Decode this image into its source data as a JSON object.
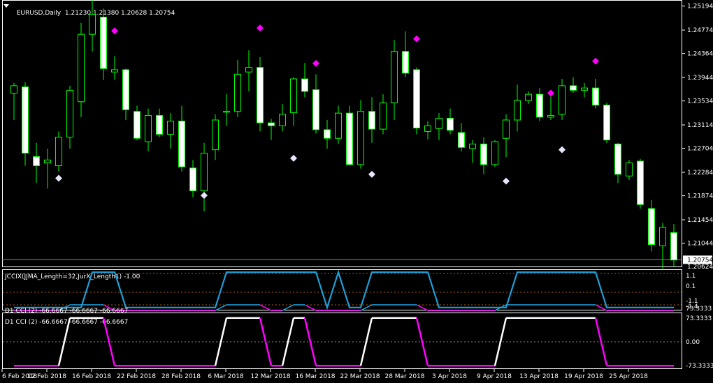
{
  "header": {
    "symbol": "EURUSD,Daily",
    "ohlc": "1.21230 1.21380 1.20628 1.20754"
  },
  "price_axis": {
    "labels": [
      "1.25194",
      "1.24774",
      "1.24364",
      "1.23944",
      "1.23534",
      "1.23114",
      "1.22704",
      "1.22284",
      "1.21874",
      "1.21454",
      "1.21044"
    ],
    "current_price": "1.20754",
    "bottom_label": "1.20624"
  },
  "indicator1": {
    "title": "JCCIX(JJMA_Length=32,JurX_Length1) -1.00",
    "axis_labels": [
      "1.1",
      "0.1",
      "-1.1",
      "-1.4"
    ],
    "overlay_title": "D1 CCI (2) -66.6667 -66.6667 -66.6667",
    "overlay_axis": "73.3333"
  },
  "indicator2": {
    "title": "D1 CCI (2) -66.6667 -66.6667 -66.6667",
    "axis_labels": [
      "73.3333",
      "0.00",
      "-73.3333"
    ]
  },
  "time_axis": {
    "labels": [
      "6 Feb 2018",
      "12 Feb 2018",
      "16 Feb 2018",
      "22 Feb 2018",
      "28 Feb 2018",
      "6 Mar 2018",
      "12 Mar 2018",
      "16 Mar 2018",
      "22 Mar 2018",
      "28 Mar 2018",
      "3 Apr 2018",
      "9 Apr 2018",
      "13 Apr 2018",
      "19 Apr 2018",
      "25 Apr 2018"
    ]
  },
  "colors": {
    "background": "#000000",
    "bull_candle": "#00ff00",
    "bear_body": "#ffffff",
    "fractal_up": "#ff00ff",
    "fractal_down": "#e6e6fa",
    "jccix_line": "#1e9fd8",
    "cci_high": "#ffffff",
    "cci_low": "#ff00ff",
    "grid": "#b06000"
  },
  "chart_data": {
    "type": "candlestick",
    "candles": [
      {
        "o": 1.2367,
        "h": 1.2385,
        "l": 1.232,
        "c": 1.238
      },
      {
        "o": 1.2378,
        "h": 1.2386,
        "l": 1.224,
        "c": 1.2262
      },
      {
        "o": 1.2256,
        "h": 1.228,
        "l": 1.221,
        "c": 1.224
      },
      {
        "o": 1.2245,
        "h": 1.227,
        "l": 1.22,
        "c": 1.225
      },
      {
        "o": 1.224,
        "h": 1.23,
        "l": 1.223,
        "c": 1.229
      },
      {
        "o": 1.229,
        "h": 1.238,
        "l": 1.227,
        "c": 1.2372
      },
      {
        "o": 1.2352,
        "h": 1.249,
        "l": 1.2325,
        "c": 1.247
      },
      {
        "o": 1.247,
        "h": 1.254,
        "l": 1.244,
        "c": 1.2505
      },
      {
        "o": 1.25,
        "h": 1.2515,
        "l": 1.239,
        "c": 1.241
      },
      {
        "o": 1.2404,
        "h": 1.2432,
        "l": 1.239,
        "c": 1.2408
      },
      {
        "o": 1.2408,
        "h": 1.241,
        "l": 1.232,
        "c": 1.2338
      },
      {
        "o": 1.2335,
        "h": 1.2345,
        "l": 1.2285,
        "c": 1.2288
      },
      {
        "o": 1.2282,
        "h": 1.234,
        "l": 1.2265,
        "c": 1.2328
      },
      {
        "o": 1.2328,
        "h": 1.234,
        "l": 1.229,
        "c": 1.2295
      },
      {
        "o": 1.2295,
        "h": 1.2332,
        "l": 1.227,
        "c": 1.2318
      },
      {
        "o": 1.2318,
        "h": 1.2345,
        "l": 1.223,
        "c": 1.2238
      },
      {
        "o": 1.2236,
        "h": 1.225,
        "l": 1.2185,
        "c": 1.2196
      },
      {
        "o": 1.2196,
        "h": 1.228,
        "l": 1.216,
        "c": 1.2262
      },
      {
        "o": 1.2268,
        "h": 1.233,
        "l": 1.225,
        "c": 1.232
      },
      {
        "o": 1.2335,
        "h": 1.2365,
        "l": 1.231,
        "c": 1.2335
      },
      {
        "o": 1.2335,
        "h": 1.2425,
        "l": 1.2325,
        "c": 1.24
      },
      {
        "o": 1.2404,
        "h": 1.2442,
        "l": 1.237,
        "c": 1.2412
      },
      {
        "o": 1.2412,
        "h": 1.243,
        "l": 1.23,
        "c": 1.2315
      },
      {
        "o": 1.2315,
        "h": 1.2322,
        "l": 1.2285,
        "c": 1.231
      },
      {
        "o": 1.231,
        "h": 1.2348,
        "l": 1.23,
        "c": 1.233
      },
      {
        "o": 1.2333,
        "h": 1.2395,
        "l": 1.231,
        "c": 1.2392
      },
      {
        "o": 1.2392,
        "h": 1.242,
        "l": 1.236,
        "c": 1.237
      },
      {
        "o": 1.2373,
        "h": 1.24,
        "l": 1.2296,
        "c": 1.2303
      },
      {
        "o": 1.2303,
        "h": 1.232,
        "l": 1.227,
        "c": 1.2288
      },
      {
        "o": 1.2288,
        "h": 1.2345,
        "l": 1.2278,
        "c": 1.2332
      },
      {
        "o": 1.2332,
        "h": 1.2345,
        "l": 1.224,
        "c": 1.2242
      },
      {
        "o": 1.2242,
        "h": 1.2355,
        "l": 1.2235,
        "c": 1.2335
      },
      {
        "o": 1.2335,
        "h": 1.236,
        "l": 1.228,
        "c": 1.2304
      },
      {
        "o": 1.2304,
        "h": 1.2365,
        "l": 1.2295,
        "c": 1.235
      },
      {
        "o": 1.235,
        "h": 1.246,
        "l": 1.232,
        "c": 1.244
      },
      {
        "o": 1.244,
        "h": 1.2475,
        "l": 1.2395,
        "c": 1.2402
      },
      {
        "o": 1.2408,
        "h": 1.2412,
        "l": 1.2295,
        "c": 1.2306
      },
      {
        "o": 1.23,
        "h": 1.2318,
        "l": 1.2286,
        "c": 1.231
      },
      {
        "o": 1.2305,
        "h": 1.2332,
        "l": 1.2285,
        "c": 1.2323
      },
      {
        "o": 1.2323,
        "h": 1.234,
        "l": 1.2295,
        "c": 1.2302
      },
      {
        "o": 1.2298,
        "h": 1.2315,
        "l": 1.2265,
        "c": 1.2272
      },
      {
        "o": 1.227,
        "h": 1.2285,
        "l": 1.2245,
        "c": 1.2278
      },
      {
        "o": 1.2278,
        "h": 1.229,
        "l": 1.2225,
        "c": 1.2242
      },
      {
        "o": 1.2242,
        "h": 1.2285,
        "l": 1.2238,
        "c": 1.2282
      },
      {
        "o": 1.2288,
        "h": 1.233,
        "l": 1.2255,
        "c": 1.232
      },
      {
        "o": 1.232,
        "h": 1.2382,
        "l": 1.23,
        "c": 1.2354
      },
      {
        "o": 1.2354,
        "h": 1.237,
        "l": 1.2348,
        "c": 1.2365
      },
      {
        "o": 1.2365,
        "h": 1.2376,
        "l": 1.2318,
        "c": 1.2325
      },
      {
        "o": 1.2325,
        "h": 1.237,
        "l": 1.232,
        "c": 1.2328
      },
      {
        "o": 1.233,
        "h": 1.2392,
        "l": 1.232,
        "c": 1.238
      },
      {
        "o": 1.238,
        "h": 1.2395,
        "l": 1.2368,
        "c": 1.2372
      },
      {
        "o": 1.2372,
        "h": 1.2385,
        "l": 1.236,
        "c": 1.2376
      },
      {
        "o": 1.2376,
        "h": 1.2392,
        "l": 1.234,
        "c": 1.2346
      },
      {
        "o": 1.2346,
        "h": 1.235,
        "l": 1.228,
        "c": 1.2285
      },
      {
        "o": 1.2278,
        "h": 1.228,
        "l": 1.221,
        "c": 1.2225
      },
      {
        "o": 1.2222,
        "h": 1.225,
        "l": 1.2215,
        "c": 1.2245
      },
      {
        "o": 1.2248,
        "h": 1.2252,
        "l": 1.2165,
        "c": 1.2172
      },
      {
        "o": 1.2165,
        "h": 1.218,
        "l": 1.209,
        "c": 1.2102
      },
      {
        "o": 1.21,
        "h": 1.214,
        "l": 1.206,
        "c": 1.2132
      },
      {
        "o": 1.2123,
        "h": 1.2138,
        "l": 1.2063,
        "c": 1.2075
      }
    ],
    "fractals_up": [
      {
        "i": 9,
        "v": 1.2476
      },
      {
        "i": 22,
        "v": 1.2481
      },
      {
        "i": 27,
        "v": 1.2419
      },
      {
        "i": 36,
        "v": 1.2462
      },
      {
        "i": 48,
        "v": 1.2367
      },
      {
        "i": 52,
        "v": 1.2423
      }
    ],
    "fractals_down": [
      {
        "i": 4,
        "v": 1.2218
      },
      {
        "i": 17,
        "v": 1.2188
      },
      {
        "i": 25,
        "v": 1.2253
      },
      {
        "i": 32,
        "v": 1.2225
      },
      {
        "i": 44,
        "v": 1.2213
      },
      {
        "i": 49,
        "v": 1.2268
      }
    ],
    "y_range": [
      1.20624,
      1.253
    ],
    "jccix": {
      "ylim": [
        -1.5,
        1.2
      ],
      "high": 1.05,
      "low": -1.35,
      "segments_high": [
        [
          7,
          9
        ],
        [
          19,
          27
        ],
        [
          32,
          37
        ],
        [
          45,
          52
        ]
      ],
      "dip": [
        28,
        31
      ]
    },
    "cci": {
      "ylim": [
        -90,
        90
      ],
      "high": 73.3333,
      "low": -73.3333,
      "segments_high": [
        [
          5,
          8
        ],
        [
          19,
          22
        ],
        [
          25,
          26
        ],
        [
          32,
          36
        ],
        [
          44,
          48
        ],
        [
          49,
          52
        ]
      ]
    }
  }
}
